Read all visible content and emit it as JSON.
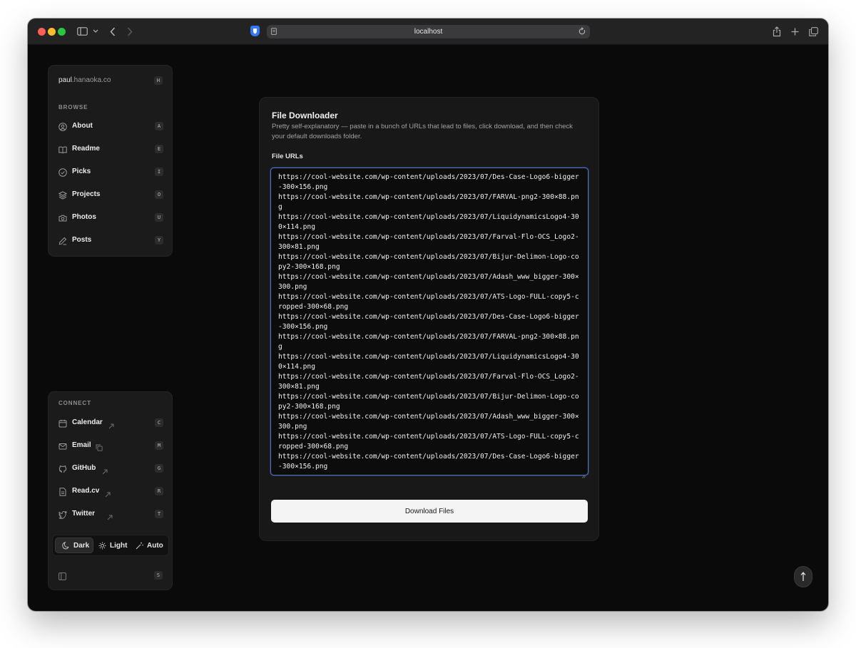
{
  "browser": {
    "url": "localhost"
  },
  "sidebar": {
    "brand_main": "paul",
    "brand_dim": ".hanaoka.co",
    "brand_shortcut": "H",
    "browse_label": "BROWSE",
    "browse_items": [
      {
        "label": "About",
        "shortcut": "A",
        "icon": "user-circle-icon"
      },
      {
        "label": "Readme",
        "shortcut": "E",
        "icon": "book-open-icon"
      },
      {
        "label": "Picks",
        "shortcut": "I",
        "icon": "check-circle-icon"
      },
      {
        "label": "Projects",
        "shortcut": "O",
        "icon": "layers-icon"
      },
      {
        "label": "Photos",
        "shortcut": "U",
        "icon": "camera-icon"
      },
      {
        "label": "Posts",
        "shortcut": "Y",
        "icon": "pencil-icon"
      }
    ],
    "connect_label": "CONNECT",
    "connect_items": [
      {
        "label": "Calendar",
        "shortcut": "C",
        "icon": "calendar-icon",
        "trail": "external-link-icon"
      },
      {
        "label": "Email",
        "shortcut": "M",
        "icon": "mail-icon",
        "trail": "copy-icon"
      },
      {
        "label": "GitHub",
        "shortcut": "G",
        "icon": "github-icon",
        "trail": "external-link-icon"
      },
      {
        "label": "Read.cv",
        "shortcut": "R",
        "icon": "document-icon",
        "trail": "external-link-icon"
      },
      {
        "label": "Twitter",
        "shortcut": "T",
        "icon": "twitter-icon",
        "trail": "external-link-icon"
      }
    ],
    "theme": {
      "dark": "Dark",
      "light": "Light",
      "auto": "Auto",
      "selected": "Dark"
    },
    "collapse_shortcut": "S"
  },
  "main": {
    "title": "File Downloader",
    "description": "Pretty self-explanatory — paste in a bunch of URLs that lead to files, click download, and then check your default downloads folder.",
    "field_label": "File URLs",
    "urls": "https://cool-website.com/wp-content/uploads/2023/07/Des-Case-Logo6-bigger-300×156.png\nhttps://cool-website.com/wp-content/uploads/2023/07/FARVAL-png2-300×88.png\nhttps://cool-website.com/wp-content/uploads/2023/07/LiquidynamicsLogo4-300×114.png\nhttps://cool-website.com/wp-content/uploads/2023/07/Farval-Flo-OCS_Logo2-300×81.png\nhttps://cool-website.com/wp-content/uploads/2023/07/Bijur-Delimon-Logo-copy2-300×168.png\nhttps://cool-website.com/wp-content/uploads/2023/07/Adash_www_bigger-300×300.png\nhttps://cool-website.com/wp-content/uploads/2023/07/ATS-Logo-FULL-copy5-cropped-300×68.png\nhttps://cool-website.com/wp-content/uploads/2023/07/Des-Case-Logo6-bigger-300×156.png\nhttps://cool-website.com/wp-content/uploads/2023/07/FARVAL-png2-300×88.png\nhttps://cool-website.com/wp-content/uploads/2023/07/LiquidynamicsLogo4-300×114.png\nhttps://cool-website.com/wp-content/uploads/2023/07/Farval-Flo-OCS_Logo2-300×81.png\nhttps://cool-website.com/wp-content/uploads/2023/07/Bijur-Delimon-Logo-copy2-300×168.png\nhttps://cool-website.com/wp-content/uploads/2023/07/Adash_www_bigger-300×300.png\nhttps://cool-website.com/wp-content/uploads/2023/07/ATS-Logo-FULL-copy5-cropped-300×68.png\nhttps://cool-website.com/wp-content/uploads/2023/07/Des-Case-Logo6-bigger-300×156.png",
    "download_label": "Download Files"
  },
  "colors": {
    "page_bg": "#0a0a0a",
    "card_bg": "#191818",
    "focus_ring": "#4e6fb5",
    "button_bg": "#f4f4f4"
  }
}
